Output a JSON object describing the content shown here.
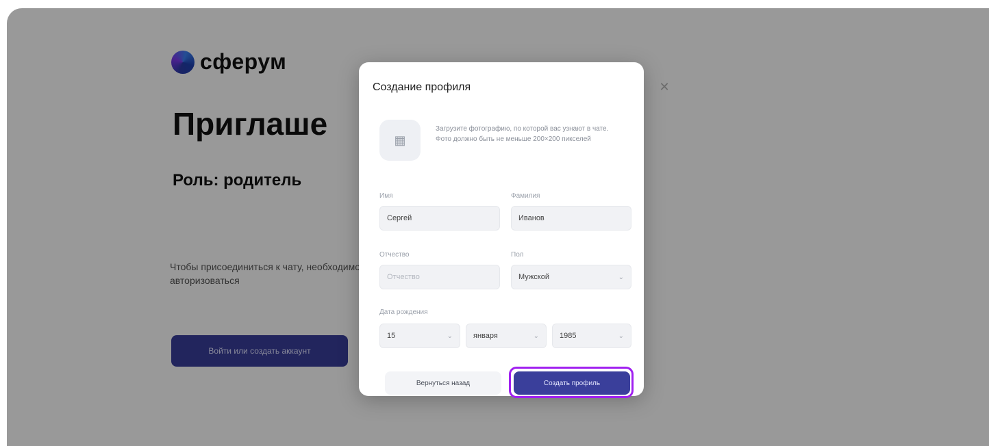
{
  "background": {
    "logo_text": "сферум",
    "title": "Приглаше",
    "role": "Роль: родитель",
    "role_tail": "",
    "text": "Чтобы присоединиться к чату, необходимо авторизоваться",
    "button_label": "Войти или создать аккаунт"
  },
  "modal": {
    "title": "Создание профиля",
    "photo_hint": "Загрузите фотографию, по которой вас узнают в чате. Фото должно быть не меньше 200×200 пикселей",
    "first_name": {
      "label": "Имя",
      "value": "Сергей"
    },
    "last_name": {
      "label": "Фамилия",
      "value": "Иванов"
    },
    "patronymic": {
      "label": "Отчество",
      "placeholder": "Отчество"
    },
    "gender": {
      "label": "Пол",
      "value": "Мужской"
    },
    "birth_date": {
      "label": "Дата рождения",
      "day": "15",
      "month": "января",
      "year": "1985"
    },
    "secondary_button": "Вернуться назад",
    "primary_button": "Создать профиль"
  },
  "colors": {
    "accent": "#3a3f9b",
    "highlight": "#a020f0",
    "overlay": "rgba(0,0,0,0.40)"
  }
}
